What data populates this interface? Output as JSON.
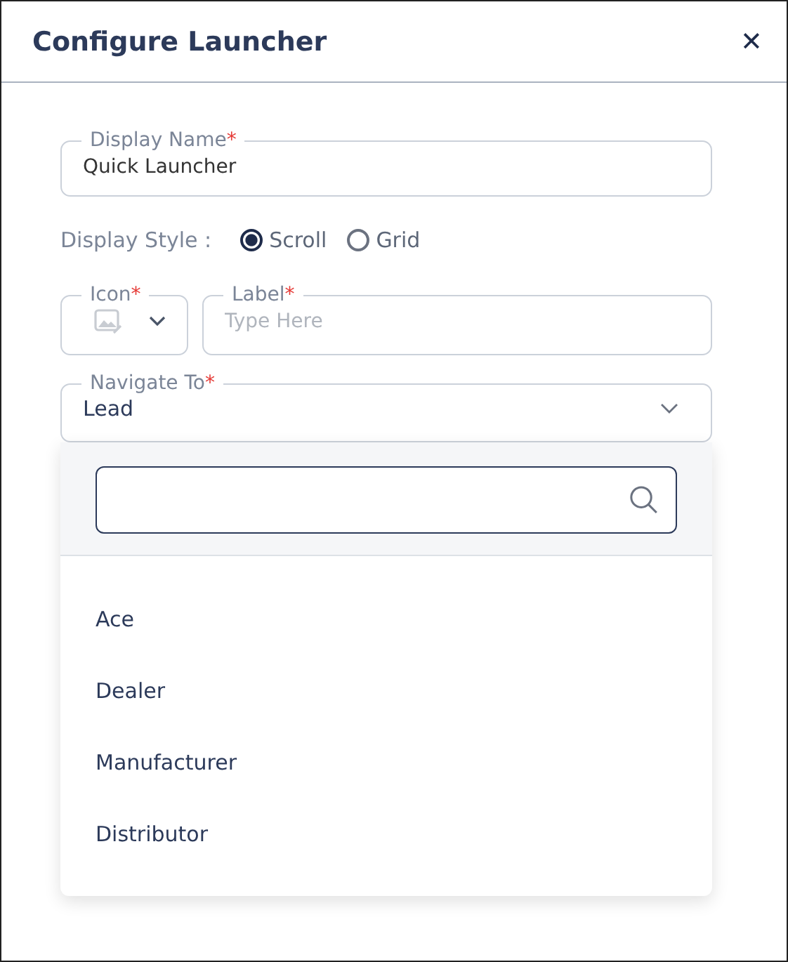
{
  "dialog": {
    "title": "Configure Launcher",
    "close": "✕"
  },
  "display_name": {
    "label": "Display Name",
    "required_mark": "*",
    "value": "Quick Launcher"
  },
  "display_style": {
    "label": "Display Style :",
    "options": [
      {
        "label": "Scroll",
        "selected": true
      },
      {
        "label": "Grid",
        "selected": false
      }
    ]
  },
  "icon_field": {
    "label": "Icon",
    "required_mark": "*"
  },
  "label_field": {
    "label": "Label",
    "required_mark": "*",
    "placeholder": "Type Here"
  },
  "navigate_to": {
    "label": "Navigate To",
    "required_mark": "*",
    "value": "Lead",
    "expanded": true,
    "options": [
      {
        "label": "Ace"
      },
      {
        "label": "Dealer"
      },
      {
        "label": "Manufacturer"
      },
      {
        "label": "Distributor"
      }
    ]
  }
}
